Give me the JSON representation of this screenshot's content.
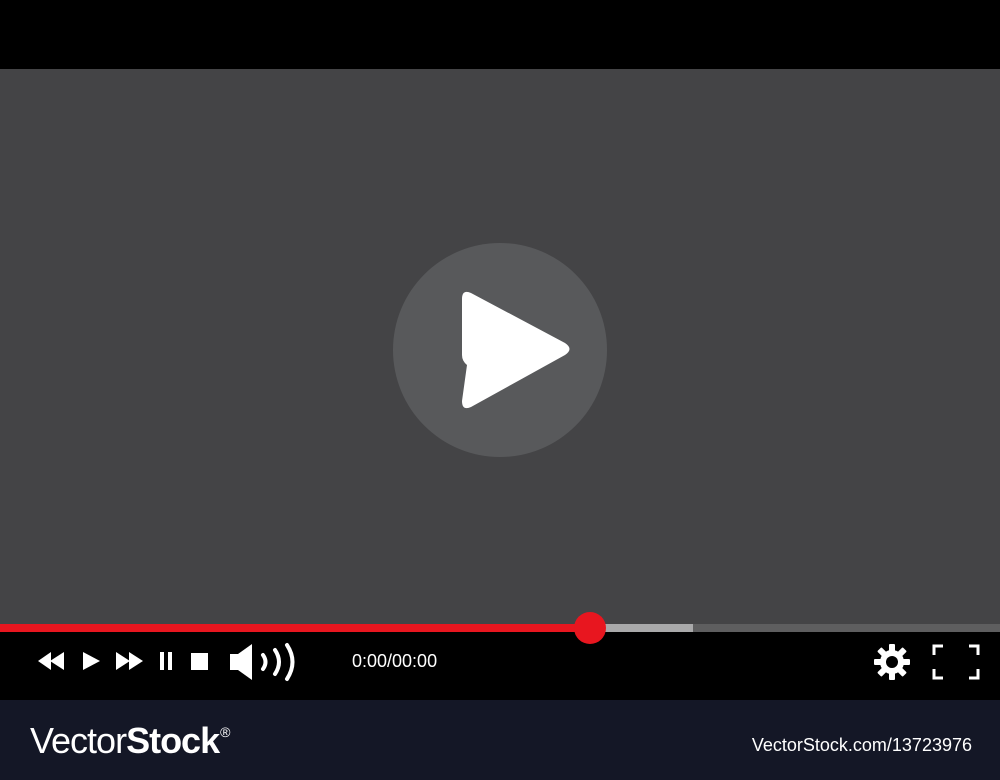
{
  "player": {
    "time_display": "0:00/00:00",
    "progress_played": 0.59,
    "progress_buffered": 0.693
  },
  "colors": {
    "accent": "#e8161f",
    "video_background": "#444446",
    "play_circle": "#58595b",
    "control_bar": "#000000",
    "footer": "#141726",
    "icon": "#ffffff"
  },
  "icons": {
    "big_play": "play-icon",
    "rewind": "rewind-icon",
    "play": "play-icon",
    "fast_forward": "fast-forward-icon",
    "pause": "pause-icon",
    "stop": "stop-icon",
    "volume": "volume-icon",
    "settings": "gear-icon",
    "fullscreen": "fullscreen-icon"
  },
  "footer": {
    "brand_prefix": "Vector",
    "brand_bold": "Stock",
    "brand_reg": "®",
    "image_id": "VectorStock.com/13723976"
  }
}
